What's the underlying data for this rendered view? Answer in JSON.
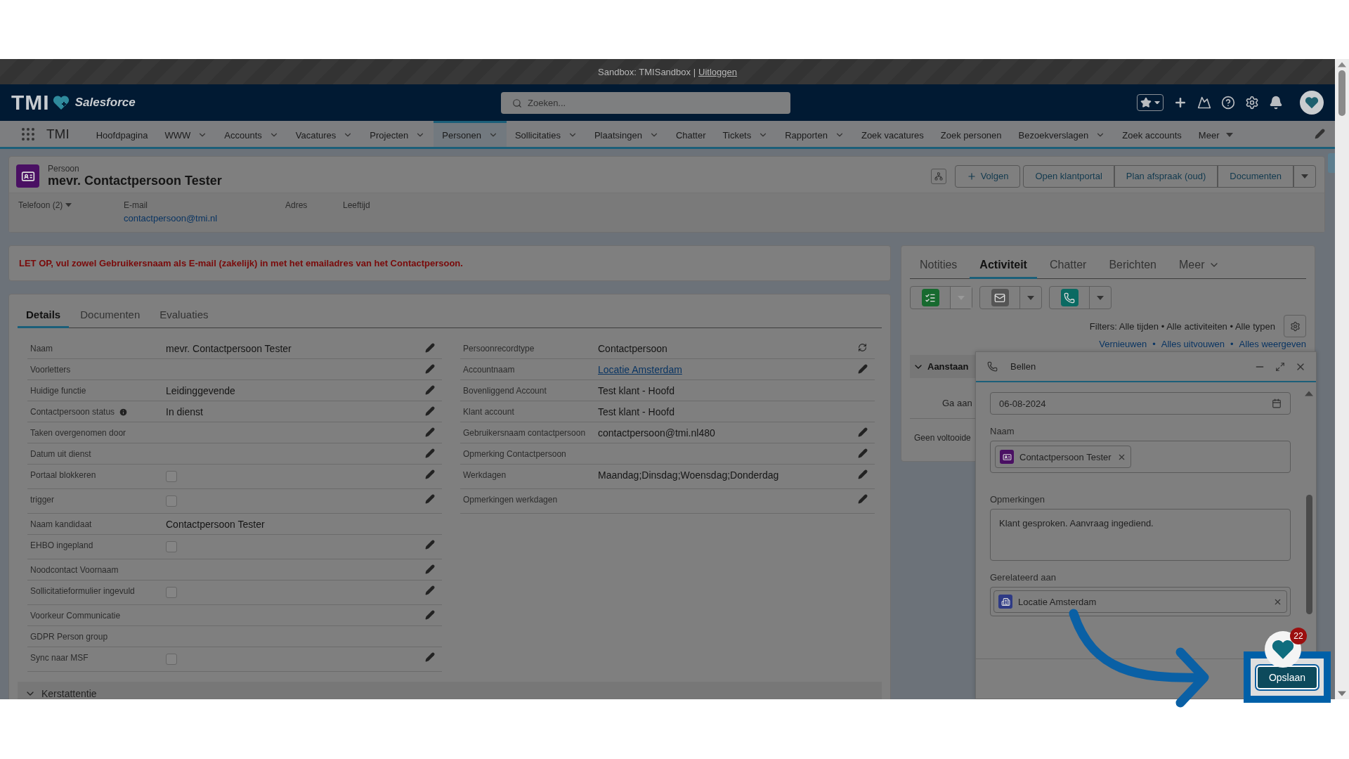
{
  "sandbox_bar": {
    "text": "Sandbox: TMISandbox |",
    "link": "Uitloggen"
  },
  "header": {
    "brand": "TMI",
    "product": "Salesforce",
    "search": {
      "placeholder": "Zoeken..."
    }
  },
  "nav": {
    "app_name": "TMI",
    "items": [
      {
        "label": "Hoofdpagina",
        "kind": "link",
        "selected": false
      },
      {
        "label": "WWW",
        "kind": "menu",
        "selected": false
      },
      {
        "label": "Accounts",
        "kind": "menu",
        "selected": false
      },
      {
        "label": "Vacatures",
        "kind": "menu",
        "selected": false
      },
      {
        "label": "Projecten",
        "kind": "menu",
        "selected": false
      },
      {
        "label": "Personen",
        "kind": "menu",
        "selected": true
      },
      {
        "label": "Sollicitaties",
        "kind": "menu",
        "selected": false
      },
      {
        "label": "Plaatsingen",
        "kind": "menu",
        "selected": false
      },
      {
        "label": "Chatter",
        "kind": "link",
        "selected": false
      },
      {
        "label": "Tickets",
        "kind": "menu",
        "selected": false
      },
      {
        "label": "Rapporten",
        "kind": "menu",
        "selected": false
      },
      {
        "label": "Zoek vacatures",
        "kind": "link",
        "selected": false
      },
      {
        "label": "Zoek personen",
        "kind": "link",
        "selected": false
      },
      {
        "label": "Bezoekverslagen",
        "kind": "menu",
        "selected": false
      },
      {
        "label": "Zoek accounts",
        "kind": "link",
        "selected": false
      },
      {
        "label": "Meer",
        "kind": "more",
        "selected": false
      }
    ]
  },
  "record": {
    "object_type": "Persoon",
    "title": "mevr. Contactpersoon Tester",
    "actions": [
      {
        "label": "Volgen",
        "kind": "follow"
      },
      {
        "label": "Open klantportal",
        "kind": "button"
      },
      {
        "label": "Plan afspraak (oud)",
        "kind": "button"
      },
      {
        "label": "Documenten",
        "kind": "button"
      }
    ],
    "highlights": [
      {
        "label": "Telefoon (2)",
        "kind": "dropdown"
      },
      {
        "label": "E-mail",
        "kind": "field",
        "value": "contactpersoon@tmi.nl"
      },
      {
        "label": "Adres",
        "kind": "field"
      },
      {
        "label": "Leeftijd",
        "kind": "field"
      }
    ]
  },
  "warning": "LET OP, vul zowel Gebruikersnaam als E-mail (zakelijk) in met het emailadres van het Contactpersoon.",
  "details": {
    "tabs": [
      {
        "label": "Details",
        "selected": true
      },
      {
        "label": "Documenten",
        "selected": false
      },
      {
        "label": "Evaluaties",
        "selected": false
      }
    ],
    "left_fields": [
      {
        "label": "Naam",
        "kind": "text",
        "value": "mevr. Contactpersoon Tester",
        "editable": true,
        "info": false
      },
      {
        "label": "Voorletters",
        "kind": "text",
        "editable": true,
        "info": false
      },
      {
        "label": "Huidige functie",
        "kind": "text",
        "value": "Leidinggevende",
        "editable": true,
        "info": false
      },
      {
        "label": "Contactpersoon status",
        "kind": "text",
        "value": "In dienst",
        "editable": true,
        "info": true
      },
      {
        "label": "Taken overgenomen door",
        "kind": "text",
        "editable": true,
        "info": false
      },
      {
        "label": "Datum uit dienst",
        "kind": "text",
        "editable": true,
        "info": false
      },
      {
        "label": "Portaal blokkeren",
        "kind": "checkbox",
        "checked": false,
        "editable": true,
        "info": false
      },
      {
        "label": "trigger",
        "kind": "checkbox",
        "checked": false,
        "editable": true,
        "info": false
      },
      {
        "label": "Naam kandidaat",
        "kind": "text",
        "value": "Contactpersoon Tester",
        "editable": false,
        "info": false
      },
      {
        "label": "EHBO ingepland",
        "kind": "checkbox",
        "checked": false,
        "editable": true,
        "info": false
      },
      {
        "label": "Noodcontact Voornaam",
        "kind": "text",
        "editable": true,
        "info": false
      },
      {
        "label": "Sollicitatieformulier ingevuld",
        "kind": "checkbox",
        "checked": false,
        "editable": true,
        "info": false
      },
      {
        "label": "Voorkeur Communicatie",
        "kind": "text",
        "editable": true,
        "info": false
      },
      {
        "label": "GDPR Person group",
        "kind": "text",
        "editable": false,
        "info": false
      },
      {
        "label": "Sync naar MSF",
        "kind": "checkbox",
        "checked": false,
        "editable": true,
        "info": false
      }
    ],
    "right_fields": [
      {
        "label": "Persoonrecordtype",
        "kind": "text",
        "value": "Contactpersoon",
        "editable": true,
        "swap": true
      },
      {
        "label": "Accountnaam",
        "kind": "link",
        "value": "Locatie Amsterdam",
        "editable": true,
        "swap": false
      },
      {
        "label": "Bovenliggend Account",
        "kind": "text",
        "value": "Test klant - Hoofd",
        "editable": false,
        "swap": false
      },
      {
        "label": "Klant account",
        "kind": "text",
        "value": "Test klant - Hoofd",
        "editable": false,
        "swap": false
      },
      {
        "label": "Gebruikersnaam contactpersoon",
        "kind": "text",
        "value": "contactpersoon@tmi.nl480",
        "editable": true,
        "swap": false
      },
      {
        "label": "Opmerking Contactpersoon",
        "kind": "text",
        "editable": true,
        "swap": false
      },
      {
        "label": "Werkdagen",
        "kind": "text",
        "value": "Maandag;Dinsdag;Woensdag;Donderdag",
        "editable": true,
        "swap": false
      },
      {
        "label": "Opmerkingen werkdagen",
        "kind": "text",
        "editable": true,
        "swap": false
      }
    ],
    "section": "Kerstattentie"
  },
  "activity": {
    "tabs": [
      {
        "label": "Notities",
        "kind": "tab",
        "selected": false
      },
      {
        "label": "Activiteit",
        "kind": "tab",
        "selected": true
      },
      {
        "label": "Chatter",
        "kind": "tab",
        "selected": false
      },
      {
        "label": "Berichten",
        "kind": "tab",
        "selected": false
      },
      {
        "label": "Meer",
        "kind": "more",
        "selected": false
      }
    ],
    "quick_actions": [
      {
        "kind": "task",
        "menu_disabled": true
      },
      {
        "kind": "email",
        "menu_disabled": false
      },
      {
        "kind": "call",
        "menu_disabled": false
      }
    ],
    "filters": "Filters: Alle tijden • Alle activiteiten • Alle typen",
    "links": [
      "Vernieuwen",
      "Alles uitvouwen",
      "Alles weergeven"
    ],
    "separator": "•",
    "upcoming": "Aanstaan",
    "upcoming_note": "Ga aan",
    "past_note": "Geen voltooide"
  },
  "call_panel": {
    "title": "Bellen",
    "date": "06-08-2024",
    "name_label": "Naam",
    "name_value": "Contactpersoon Tester",
    "notes_label": "Opmerkingen",
    "notes": "Klant gesproken. Aanvraag ingediend.",
    "related_label": "Gerelateerd aan",
    "related_value": "Locatie Amsterdam",
    "save": "Opslaan"
  },
  "chat_widget": {
    "badge": "22"
  }
}
